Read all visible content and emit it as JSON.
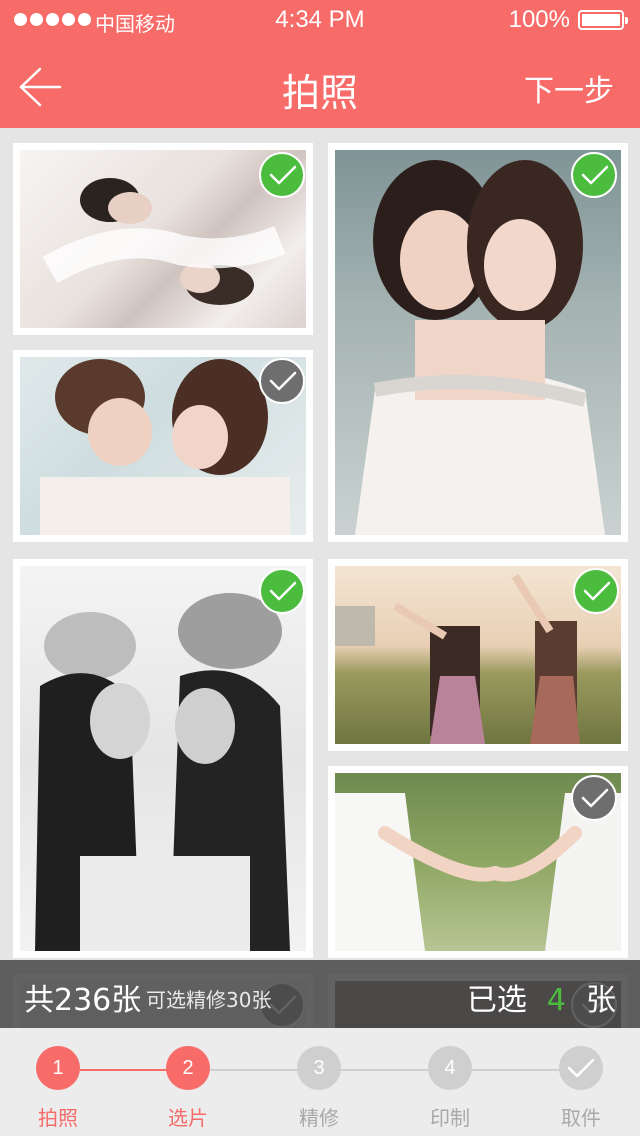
{
  "status_bar": {
    "carrier": "中国移动",
    "time": "4:34 PM",
    "battery": "100%"
  },
  "header": {
    "title": "拍照",
    "next": "下一步"
  },
  "photos": [
    {
      "selected": true
    },
    {
      "selected": true
    },
    {
      "selected": false
    },
    {
      "selected": true
    },
    {
      "selected": true
    },
    {
      "selected": false
    },
    {
      "selected": false
    },
    {
      "selected": false
    }
  ],
  "info_bar": {
    "total": "共236张",
    "optional": "可选精修30张",
    "selected_prefix": "已选",
    "selected_count": "4",
    "selected_suffix": "张"
  },
  "steps": [
    {
      "number": "1",
      "label": "拍照",
      "state": "done"
    },
    {
      "number": "2",
      "label": "选片",
      "state": "current"
    },
    {
      "number": "3",
      "label": "精修",
      "state": "pending"
    },
    {
      "number": "4",
      "label": "印制",
      "state": "pending"
    },
    {
      "number": "",
      "label": "取件",
      "state": "pending",
      "icon": "check-icon"
    }
  ],
  "colors": {
    "accent": "#f76b69",
    "check_on": "#4cbc3f",
    "check_off": "#6e6e6e",
    "pending": "#cfcfcf"
  }
}
